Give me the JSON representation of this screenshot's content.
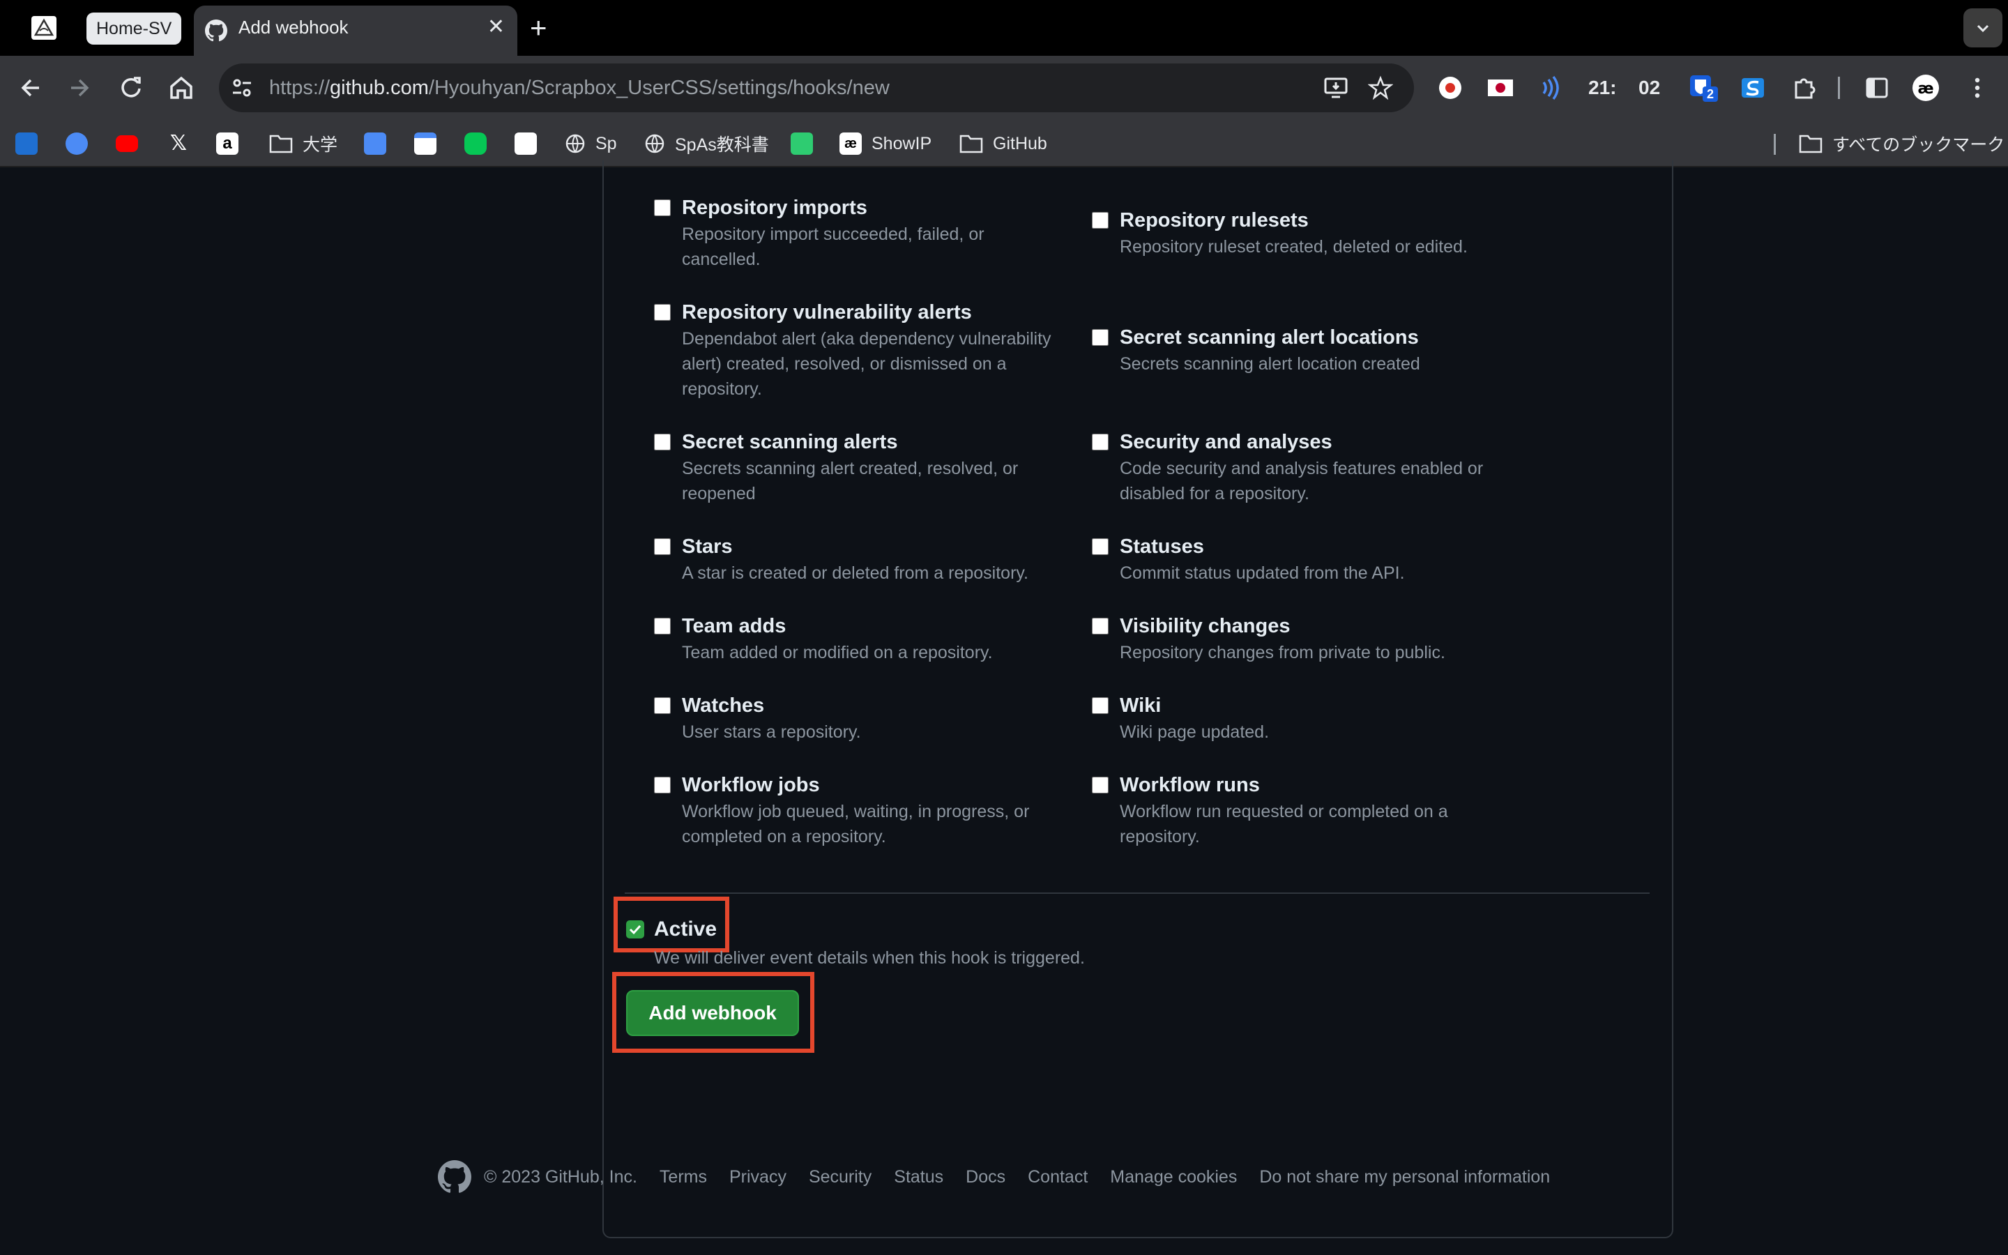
{
  "browser": {
    "tab_group_label": "Home-SV",
    "active_tab_title": "Add webhook",
    "url_scheme": "https://",
    "url_host": "github.com",
    "url_path": "/Hyouhyan/Scrapbox_UserCSS/settings/hooks/new",
    "clock_hour": "21:",
    "clock_min": "02",
    "extension_badge": "2"
  },
  "bookmarks": {
    "daigaku": "大学",
    "sp": "Sp",
    "spas": "SpAs教科書",
    "showip": "ShowIP",
    "github": "GitHub",
    "all": "すべてのブックマーク"
  },
  "events": {
    "left": [
      {
        "name": "Repository imports",
        "desc": "Repository import succeeded, failed, or cancelled."
      },
      {
        "name": "Repository vulnerability alerts",
        "desc": "Dependabot alert (aka dependency vulnerability alert) created, resolved, or dismissed on a repository."
      },
      {
        "name": "Secret scanning alerts",
        "desc": "Secrets scanning alert created, resolved, or reopened"
      },
      {
        "name": "Stars",
        "desc": "A star is created or deleted from a repository."
      },
      {
        "name": "Team adds",
        "desc": "Team added or modified on a repository."
      },
      {
        "name": "Watches",
        "desc": "User stars a repository."
      },
      {
        "name": "Workflow jobs",
        "desc": "Workflow job queued, waiting, in progress, or completed on a repository."
      }
    ],
    "right": [
      {
        "name": "Repository rulesets",
        "desc": "Repository ruleset created, deleted or edited."
      },
      {
        "name": "Secret scanning alert locations",
        "desc": "Secrets scanning alert location created"
      },
      {
        "name": "Security and analyses",
        "desc": "Code security and analysis features enabled or disabled for a repository."
      },
      {
        "name": "Statuses",
        "desc": "Commit status updated from the API."
      },
      {
        "name": "Visibility changes",
        "desc": "Repository changes from private to public."
      },
      {
        "name": "Wiki",
        "desc": "Wiki page updated."
      },
      {
        "name": "Workflow runs",
        "desc": "Workflow run requested or completed on a repository."
      }
    ]
  },
  "active": {
    "label": "Active",
    "desc": "We will deliver event details when this hook is triggered.",
    "checked": true
  },
  "submit_label": "Add webhook",
  "footer": {
    "copyright": "© 2023 GitHub, Inc.",
    "links": [
      "Terms",
      "Privacy",
      "Security",
      "Status",
      "Docs",
      "Contact",
      "Manage cookies",
      "Do not share my personal information"
    ]
  },
  "colors": {
    "page_bg": "#0d1117",
    "button_green": "#238636",
    "highlight": "#e4472d"
  }
}
